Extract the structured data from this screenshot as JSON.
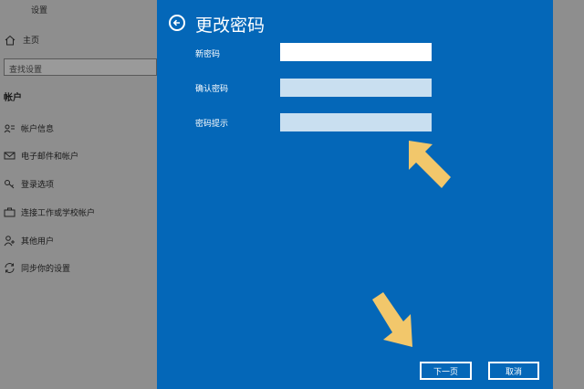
{
  "window": {
    "title": "设置"
  },
  "sidebar": {
    "home_label": "主页",
    "search_placeholder": "查找设置",
    "section_title": "帐户",
    "items": [
      {
        "label": "帐户信息",
        "icon": "person-card-icon"
      },
      {
        "label": "电子邮件和帐户",
        "icon": "mail-icon"
      },
      {
        "label": "登录选项",
        "icon": "key-icon"
      },
      {
        "label": "连接工作或学校帐户",
        "icon": "briefcase-icon"
      },
      {
        "label": "其他用户",
        "icon": "person-add-icon"
      },
      {
        "label": "同步你的设置",
        "icon": "sync-icon"
      }
    ]
  },
  "dialog": {
    "title": "更改密码",
    "fields": [
      {
        "label": "新密码",
        "value": ""
      },
      {
        "label": "确认密码",
        "value": ""
      },
      {
        "label": "密码提示",
        "value": ""
      }
    ],
    "next_label": "下一页",
    "cancel_label": "取消"
  },
  "colors": {
    "dialog_bg": "#0467b8",
    "arrow": "#f2c76b",
    "background_dim": "#8e8e8e"
  }
}
